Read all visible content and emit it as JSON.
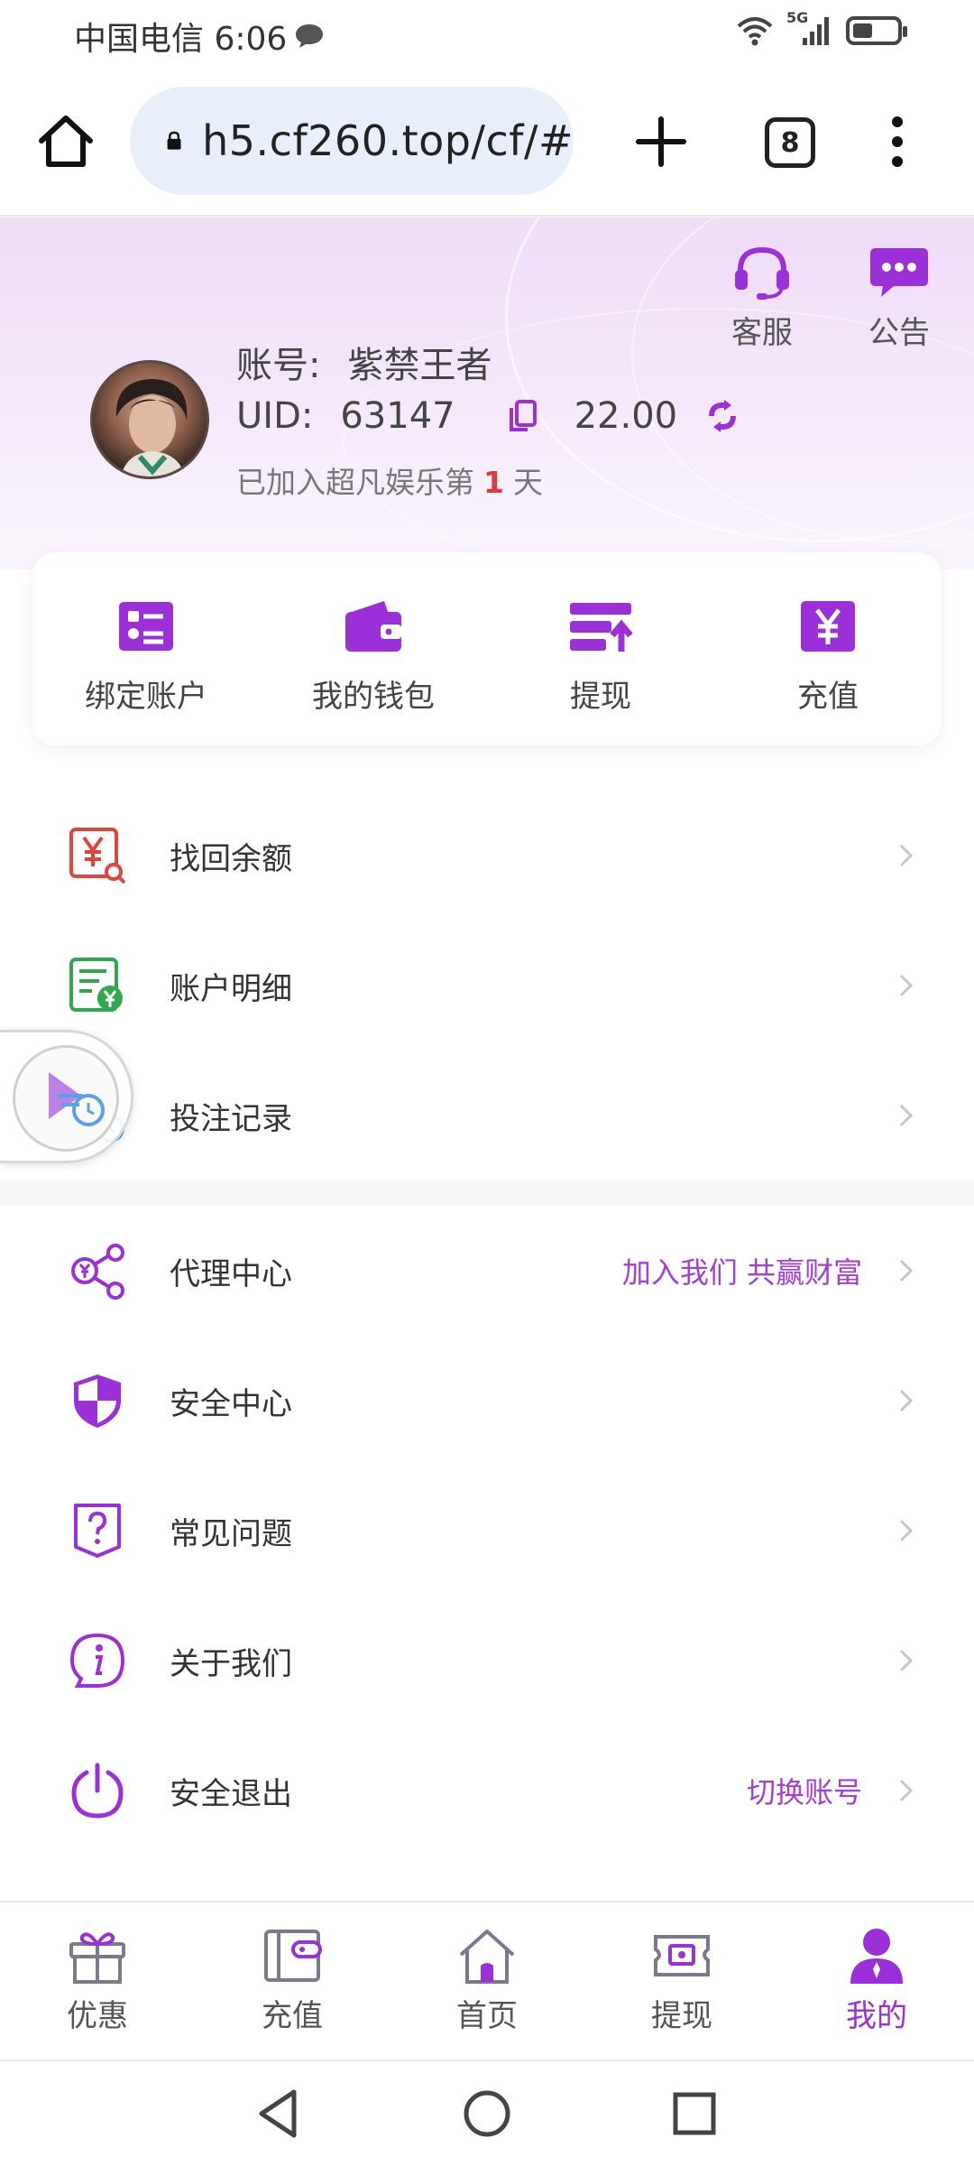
{
  "status_bar": {
    "carrier_time": "中国电信 6:06",
    "network": "5G",
    "battery_level": 0.45
  },
  "browser": {
    "url": "h5.cf260.top/cf/#",
    "tab_count": "8",
    "icons": [
      "home-icon",
      "lock-icon",
      "plus-icon",
      "tabs-icon",
      "more-vertical-icon"
    ]
  },
  "header": {
    "customer_service_label": "客服",
    "notice_label": "公告",
    "account_label": "账号:",
    "account_value": "紫禁王者",
    "uid_label": "UID:",
    "uid_value": "63147",
    "balance": "22.00",
    "joined_prefix": "已加入超凡娱乐第",
    "joined_days": "1",
    "joined_suffix": "天"
  },
  "quick_actions": [
    {
      "label": "绑定账户",
      "icon": "bind-account-icon"
    },
    {
      "label": "我的钱包",
      "icon": "wallet-icon"
    },
    {
      "label": "提现",
      "icon": "withdraw-icon"
    },
    {
      "label": "充值",
      "icon": "yuan-recharge-icon"
    }
  ],
  "menu_group_1": [
    {
      "label": "找回余额",
      "icon": "recover-balance-icon"
    },
    {
      "label": "账户明细",
      "icon": "account-details-icon"
    },
    {
      "label": "投注记录",
      "icon": "bet-record-icon"
    }
  ],
  "menu_group_2": [
    {
      "label": "代理中心",
      "extra": "加入我们 共赢财富",
      "icon": "agent-share-icon"
    },
    {
      "label": "安全中心",
      "extra": "",
      "icon": "shield-icon"
    },
    {
      "label": "常见问题",
      "extra": "",
      "icon": "question-icon"
    },
    {
      "label": "关于我们",
      "extra": "",
      "icon": "info-icon"
    },
    {
      "label": "安全退出",
      "extra": "切换账号",
      "icon": "power-icon"
    }
  ],
  "tabbar": [
    {
      "label": "优惠",
      "icon": "gift-icon",
      "active": false
    },
    {
      "label": "充值",
      "icon": "wallet-card-icon",
      "active": false
    },
    {
      "label": "首页",
      "icon": "home-tab-icon",
      "active": false
    },
    {
      "label": "提现",
      "icon": "cash-ticket-icon",
      "active": false
    },
    {
      "label": "我的",
      "icon": "user-icon",
      "active": true
    }
  ],
  "colors": {
    "accent": "#9b30d9",
    "header_bg": "#efdcf7",
    "red_icon": "#e0453b",
    "green_icon": "#2fa84f",
    "days_red": "#e03b3b"
  }
}
